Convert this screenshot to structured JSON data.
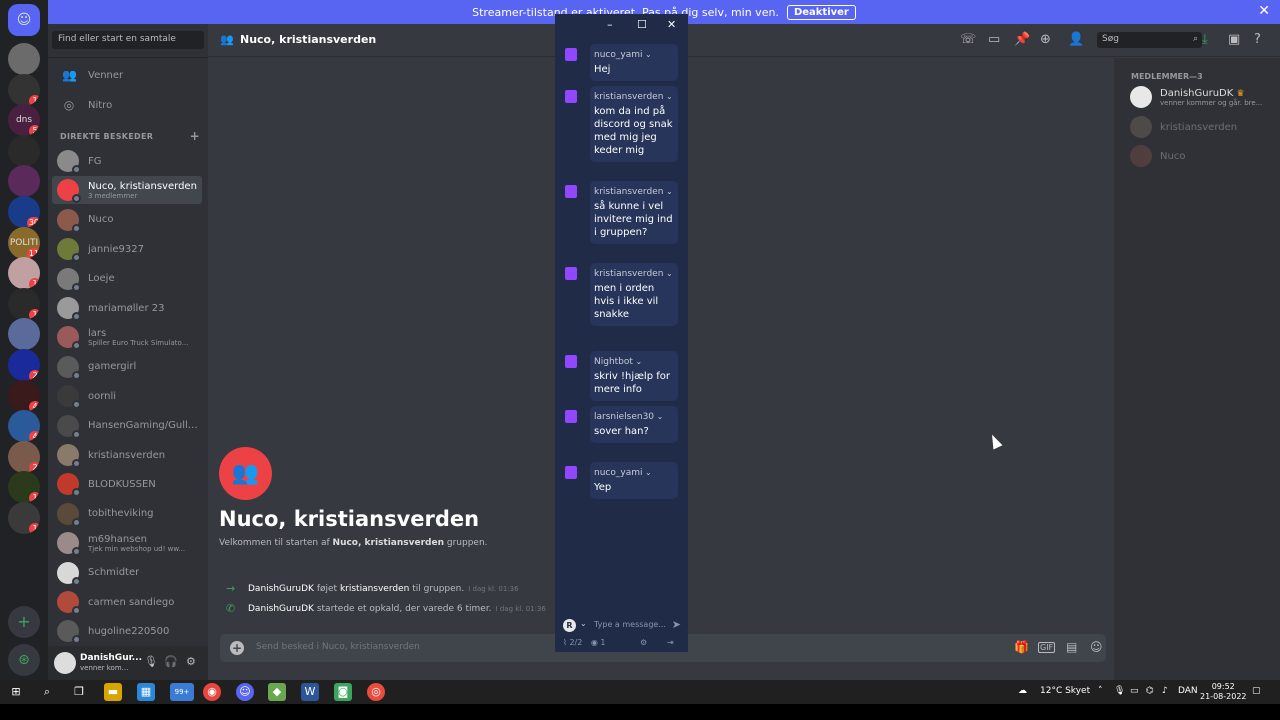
{
  "banner": {
    "text": "Streamer-tilstand er aktiveret. Pas på dig selv, min ven.",
    "button": "Deaktiver"
  },
  "servers": [
    {
      "label": "",
      "badge": ""
    },
    {
      "label": "",
      "badge": "1"
    },
    {
      "label": "dns",
      "badge": "5"
    },
    {
      "label": "",
      "badge": ""
    },
    {
      "label": "",
      "badge": ""
    },
    {
      "label": "",
      "badge": "30"
    },
    {
      "label": "POLITI",
      "badge": "11"
    },
    {
      "label": "",
      "badge": "1"
    },
    {
      "label": "",
      "badge": "1"
    },
    {
      "label": "",
      "badge": ""
    },
    {
      "label": "",
      "badge": "2"
    },
    {
      "label": "",
      "badge": "4"
    },
    {
      "label": "",
      "badge": "4"
    },
    {
      "label": "",
      "badge": "2"
    },
    {
      "label": "",
      "badge": "1"
    },
    {
      "label": "",
      "badge": "1"
    }
  ],
  "sidebar": {
    "search_placeholder": "Find eller start en samtale",
    "nav": [
      {
        "icon": "👥",
        "label": "Venner"
      },
      {
        "icon": "◎",
        "label": "Nitro"
      }
    ],
    "dm_header": "DIREKTE BESKEDER",
    "dms": [
      {
        "name": "FG",
        "sub": "",
        "color": "#8a8a8a"
      },
      {
        "name": "Nuco, kristiansverden",
        "sub": "3 medlemmer",
        "color": "#ed4245"
      },
      {
        "name": "Nuco",
        "sub": "",
        "color": "#8b5a4a"
      },
      {
        "name": "jannie9327",
        "sub": "",
        "color": "#6d7a3a"
      },
      {
        "name": "Loeje",
        "sub": "",
        "color": "#7a7a7a"
      },
      {
        "name": "mariamøller 23",
        "sub": "",
        "color": "#9a9a9a"
      },
      {
        "name": "lars",
        "sub": "Spiller Euro Truck Simulato...",
        "color": "#9a5a5a"
      },
      {
        "name": "gamergirl",
        "sub": "",
        "color": "#5a5a5a"
      },
      {
        "name": "oornli",
        "sub": "",
        "color": "#3a3a3a"
      },
      {
        "name": "HansenGaming/Gulle...",
        "sub": "",
        "color": "#4a4a4a"
      },
      {
        "name": "kristiansverden",
        "sub": "",
        "color": "#8a7a6a"
      },
      {
        "name": "BLODKUSSEN",
        "sub": "",
        "color": "#c0392b"
      },
      {
        "name": "tobitheviking",
        "sub": "",
        "color": "#5a4a3a"
      },
      {
        "name": "m69hansen",
        "sub": "Tjek min webshop ud! ww...",
        "color": "#9a8a8a"
      },
      {
        "name": "Schmidter",
        "sub": "",
        "color": "#d8d8d8"
      },
      {
        "name": "carmen sandiego",
        "sub": "",
        "color": "#b04a3a"
      },
      {
        "name": "hugoline220500",
        "sub": "",
        "color": "#5a5a5a"
      }
    ],
    "user": {
      "name": "DanishGur...",
      "status": "venner kom..."
    }
  },
  "topbar": {
    "title": "Nuco, kristiansverden",
    "search_placeholder": "Søg"
  },
  "main": {
    "title": "Nuco, kristiansverden",
    "welcome_pre": "Velkommen til starten af ",
    "welcome_bold": "Nuco, kristiansverden",
    "welcome_post": " gruppen.",
    "system": [
      {
        "icon": "→",
        "user": "DanishGuruDK",
        "action": " føjet ",
        "target": "kristiansverden",
        "tail": " til gruppen.",
        "time": "I dag kl. 01:36"
      },
      {
        "icon": "✆",
        "user": "DanishGuruDK",
        "action": " startede et opkald, der varede 6 timer.",
        "target": "",
        "tail": "",
        "time": "I dag kl. 01:36"
      }
    ],
    "composer_placeholder": "Send besked i Nuco, kristiansverden"
  },
  "members": {
    "header": "MEDLEMMER—3",
    "list": [
      {
        "name": "DanishGuruDK",
        "sub": "venner kommer og går. bre...",
        "crown": "♛"
      },
      {
        "name": "kristiansverden",
        "sub": ""
      },
      {
        "name": "Nuco",
        "sub": ""
      }
    ]
  },
  "overlay": {
    "messages": [
      {
        "user": "nuco_yami",
        "text": "Hej"
      },
      {
        "user": "kristiansverden",
        "text": "kom da ind på discord og snak med mig jeg keder mig"
      },
      {
        "user": "kristiansverden",
        "text": "så kunne i vel invitere mig ind i gruppen?"
      },
      {
        "user": "kristiansverden",
        "text": "men i orden hvis i ikke vil snakke"
      },
      {
        "user": "Nightbot",
        "text": "skriv !hjælp for mere info"
      },
      {
        "user": "larsnielsen30",
        "text": "sover han?"
      },
      {
        "user": "nuco_yami",
        "text": "Yep"
      }
    ],
    "input_placeholder": "Type a message...",
    "footer_count": "2/2",
    "footer_viewers": "1",
    "avatar_letter": "R"
  },
  "taskbar": {
    "weather": "12°C Skyet",
    "lang": "DAN",
    "time": "09:52",
    "date": "21-08-2022",
    "badge": "99+"
  }
}
